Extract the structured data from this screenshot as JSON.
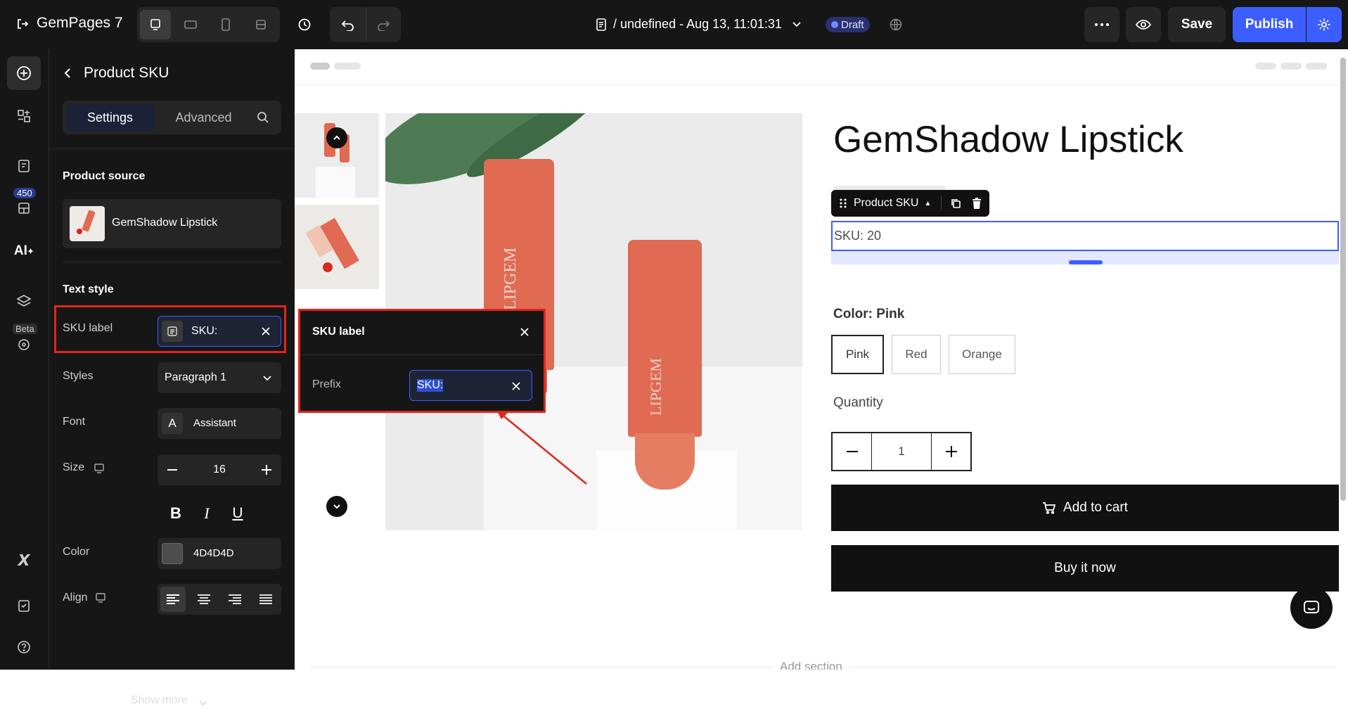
{
  "app": {
    "name": "GemPages 7"
  },
  "topbar": {
    "title": "/ undefined - Aug 13, 11:01:31",
    "status": "Draft",
    "save": "Save",
    "publish": "Publish"
  },
  "rail": {
    "badge": "450",
    "beta": "Beta"
  },
  "panel": {
    "title": "Product SKU",
    "tabs": [
      "Settings",
      "Advanced"
    ],
    "product_source_heading": "Product source",
    "product_name": "GemShadow Lipstick",
    "text_style_heading": "Text style",
    "sku_label": "SKU label",
    "sku_value": "SKU:",
    "styles_label": "Styles",
    "styles_value": "Paragraph 1",
    "font_label": "Font",
    "font_value": "Assistant",
    "size_label": "Size",
    "size_value": "16",
    "color_label": "Color",
    "color_value": "4D4D4D",
    "align_label": "Align",
    "show_more": "Show more"
  },
  "popover": {
    "title": "SKU label",
    "prefix_label": "Prefix",
    "prefix_value": "SKU:"
  },
  "product": {
    "title": "GemShadow Lipstick",
    "element_tag": "Product SKU",
    "sku_text": "SKU: 20",
    "color_label": "Color: Pink",
    "options": [
      "Pink",
      "Red",
      "Orange"
    ],
    "quantity_label": "Quantity",
    "quantity": "1",
    "add_to_cart": "Add to cart",
    "buy_now": "Buy it now",
    "add_section": "Add section"
  },
  "colors": {
    "accent": "#3C5DFF",
    "highlight": "#E1251B",
    "swatch": "#4D4D4D",
    "product": "#E06A52"
  }
}
